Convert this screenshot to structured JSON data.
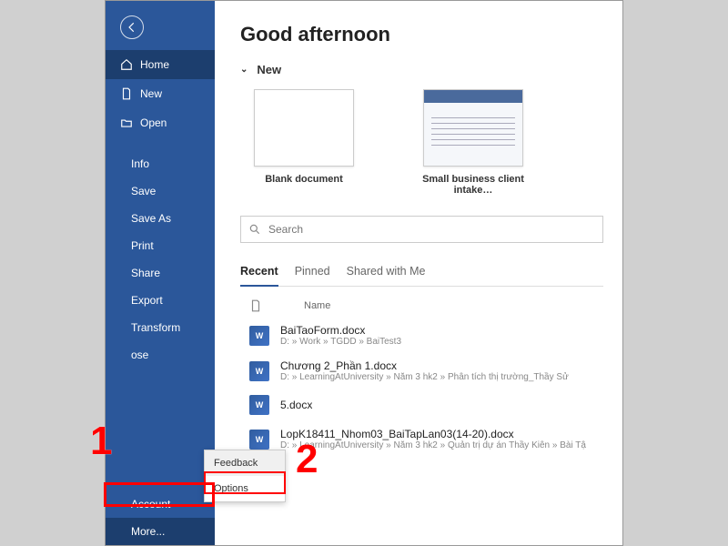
{
  "greeting": "Good afternoon",
  "sidebar": {
    "home": "Home",
    "new": "New",
    "open": "Open",
    "subs": [
      "Info",
      "Save",
      "Save As",
      "Print",
      "Share",
      "Export",
      "Transform",
      "Close",
      "Account",
      "More..."
    ]
  },
  "section_new": "New",
  "templates": [
    {
      "label": "Blank document"
    },
    {
      "label": "Small business client intake…"
    }
  ],
  "search": {
    "placeholder": "Search"
  },
  "tabs": {
    "recent": "Recent",
    "pinned": "Pinned",
    "shared": "Shared with Me"
  },
  "list_header": {
    "name": "Name"
  },
  "files": [
    {
      "name": "BaiTaoForm.docx",
      "path": "D: » Work » TGDD » BaiTest3"
    },
    {
      "name": "Chương 2_Phần 1.docx",
      "path": "D: » LearningAtUniversity » Năm 3 hk2 » Phân tích thị trường_Thầy Sử"
    },
    {
      "name": "5.docx",
      "path": ""
    },
    {
      "name": "LopK18411_Nhom03_BaiTapLan03(14-20).docx",
      "path": "D: » LearningAtUniversity » Năm 3 hk2 » Quản trị dự án Thầy Kiên » Bài Tậ"
    }
  ],
  "popup": {
    "feedback": "Feedback",
    "options": "Options"
  },
  "annot": {
    "one": "1",
    "two": "2"
  },
  "close_partial": "ose"
}
